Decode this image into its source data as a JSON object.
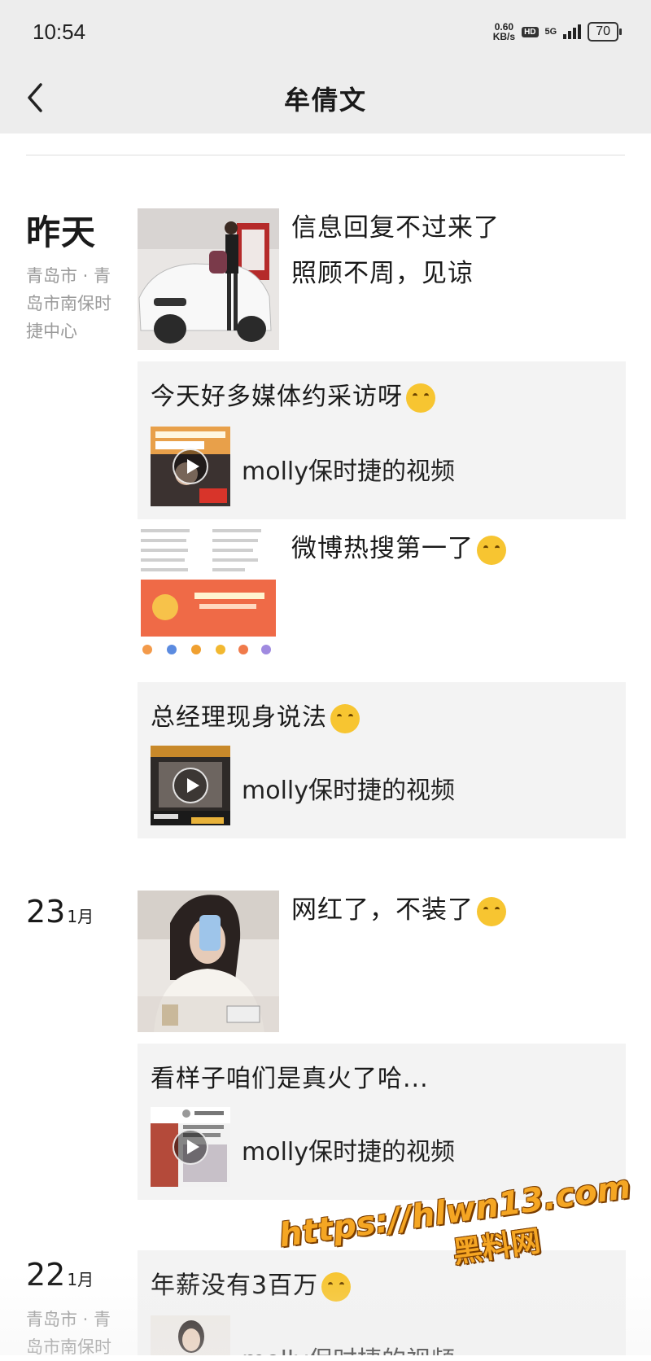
{
  "status_bar": {
    "time": "10:54",
    "net_speed_value": "0.60",
    "net_speed_unit": "KB/s",
    "hd": "HD",
    "signal": "5G",
    "battery": "70"
  },
  "nav": {
    "title": "牟倩文",
    "back_icon": "chevron-left-icon"
  },
  "groups": [
    {
      "date_big": "昨天",
      "location": "青岛市 · 青岛市南保时捷中心",
      "posts": [
        {
          "text_line1": "信息回复不过来了",
          "text_line2": "照顾不周，见谅"
        }
      ],
      "shares": [
        {
          "text": "今天好多媒体约采访呀",
          "label": "molly保时捷的视频"
        },
        {
          "text": "总经理现身说法",
          "label": "molly保时捷的视频"
        }
      ],
      "image_post": {
        "text": "微博热搜第一了"
      }
    },
    {
      "date_num": "23",
      "date_month": "1月",
      "posts": [
        {
          "text": "网红了，不装了"
        }
      ],
      "shares": [
        {
          "text": "看样子咱们是真火了哈...",
          "label": "molly保时捷的视频"
        }
      ]
    },
    {
      "date_num": "22",
      "date_month": "1月",
      "location": "青岛市 · 青岛市南保时",
      "shares": [
        {
          "text": "年薪没有3百万",
          "label": "molly保时捷的视频"
        }
      ]
    }
  ],
  "watermark": {
    "url": "https://hlwn13.com",
    "name": "黑料网"
  },
  "colors": {
    "bar_bg": "#ededed",
    "card_bg": "#f3f3f3",
    "location_text": "#9a9a9a",
    "watermark": "#f5a623"
  }
}
